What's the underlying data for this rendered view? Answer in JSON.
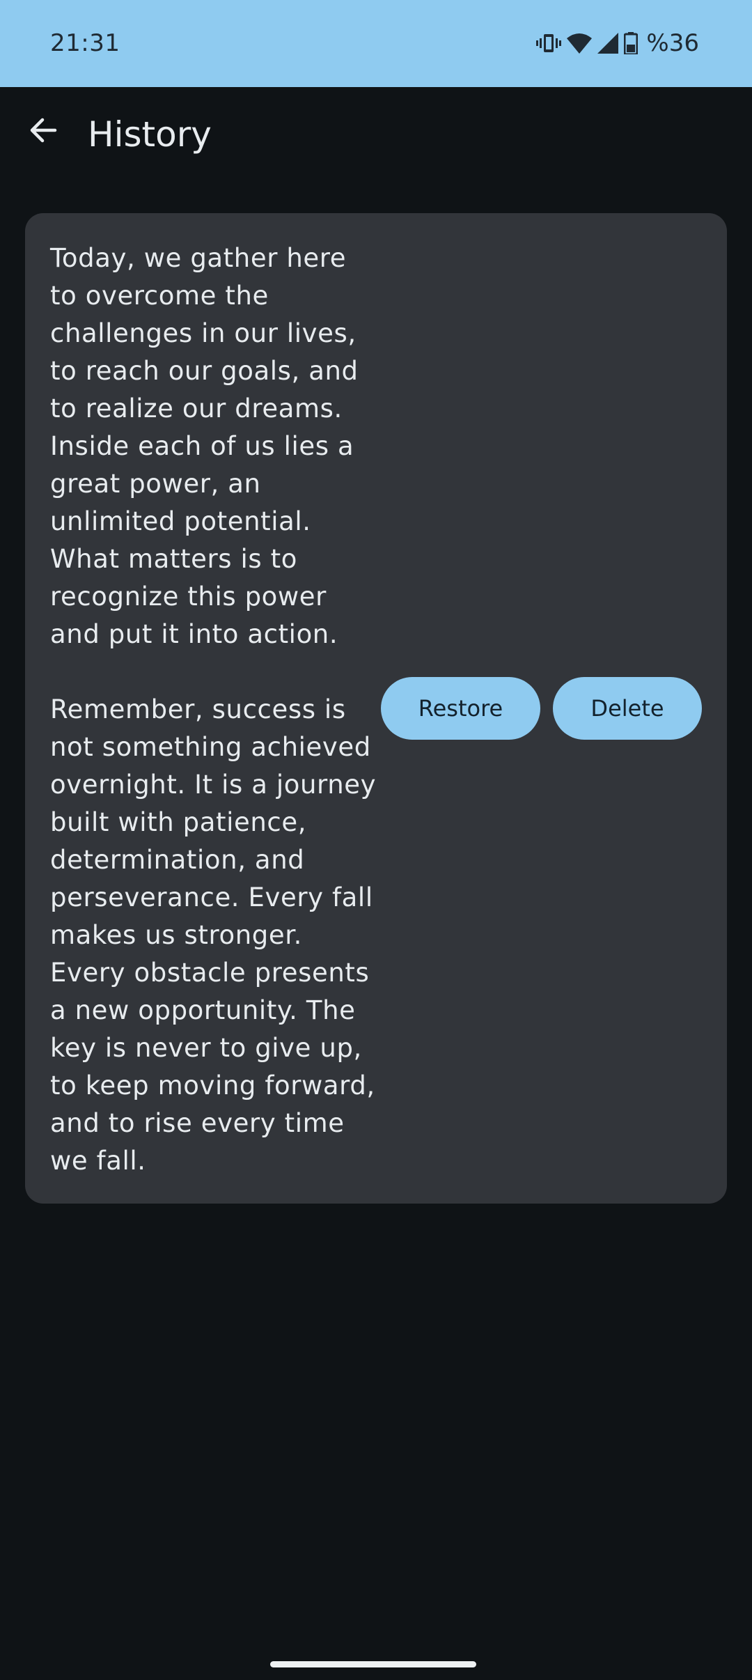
{
  "status_bar": {
    "time": "21:31",
    "icons": [
      "vibrate-icon",
      "wifi-icon",
      "signal-icon",
      "battery-icon"
    ],
    "battery_percent": "%36"
  },
  "app_bar": {
    "back_icon": "arrow-back-icon",
    "title": "History"
  },
  "history": {
    "items": [
      {
        "text": "Today, we gather here\nto overcome the\nchallenges in our lives,\nto reach our goals, and\nto realize our dreams.\nInside each of us lies a\ngreat power, an\nunlimited potential.\nWhat matters is to\nrecognize this power\nand put it into action.\n\nRemember, success is\nnot something achieved\novernight. It is a journey\nbuilt with patience,\ndetermination, and\nperseverance. Every fall\nmakes us stronger.\nEvery obstacle presents\na new opportunity. The\nkey is never to give up,\nto keep moving forward,\nand to rise every time\nwe fall.",
        "restore_label": "Restore",
        "delete_label": "Delete"
      }
    ]
  },
  "colors": {
    "status_bar_bg": "#8fcbf0",
    "page_bg": "#0f1316",
    "card_bg": "#32353a",
    "accent": "#8fcbf0",
    "text_primary": "#e8ecef"
  }
}
